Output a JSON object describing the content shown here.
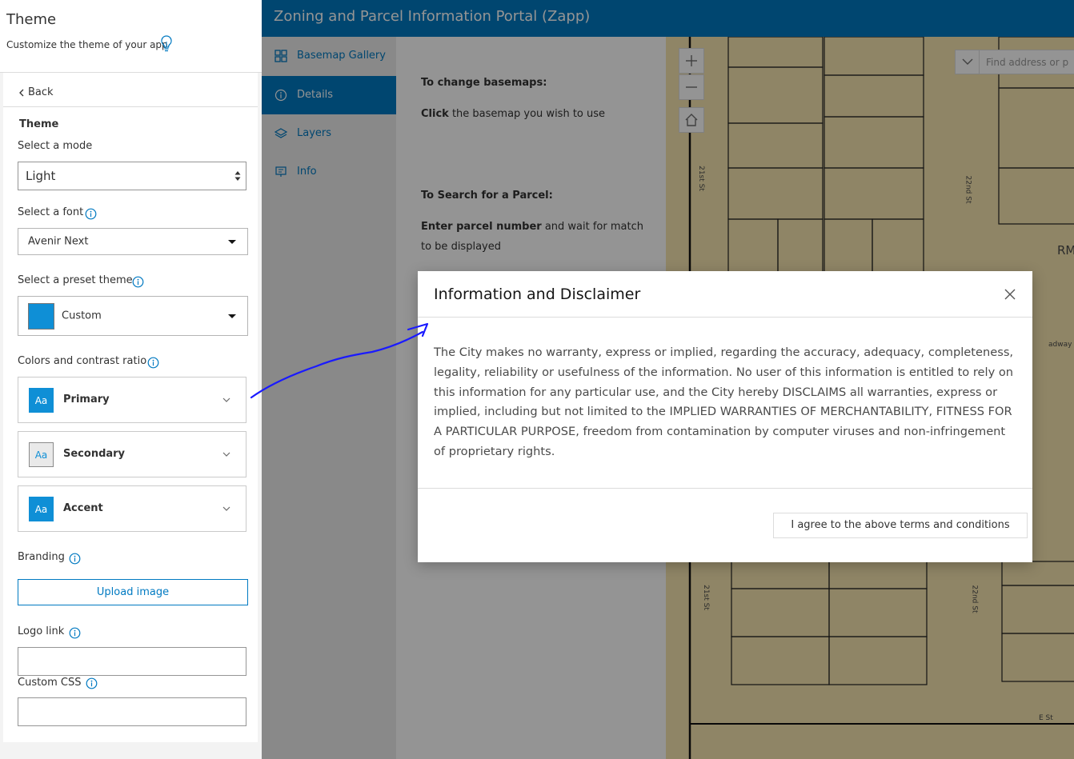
{
  "panel": {
    "title": "Theme",
    "subtitle": "Customize the theme of your app",
    "back_label": "Back",
    "section_title": "Theme",
    "mode_label": "Select a mode",
    "mode_value": "Light",
    "font_label": "Select a font",
    "font_value": "Avenir Next",
    "preset_label": "Select a preset theme",
    "preset_value": "Custom",
    "preset_color": "#0f8fd6",
    "colors_label": "Colors and contrast ratio",
    "colors": [
      {
        "label": "Primary",
        "swatch_text": "Aa",
        "swatch_bg": "#0f8fd6",
        "swatch_fg": "#ffffff"
      },
      {
        "label": "Secondary",
        "swatch_text": "Aa",
        "swatch_bg": "#e9e9e9",
        "swatch_fg": "#0f8fd6"
      },
      {
        "label": "Accent",
        "swatch_text": "Aa",
        "swatch_bg": "#0f8fd6",
        "swatch_fg": "#ffffff"
      }
    ],
    "branding_label": "Branding",
    "upload_label": "Upload image",
    "logo_link_label": "Logo link",
    "logo_link_value": "",
    "custom_css_label": "Custom CSS",
    "custom_css_value": ""
  },
  "app": {
    "title": "Zoning and Parcel Information Portal (Zapp)",
    "nav": [
      {
        "label": "Basemap Gallery",
        "icon": "grid-icon",
        "active": false
      },
      {
        "label": "Details",
        "icon": "info-icon",
        "active": true
      },
      {
        "label": "Layers",
        "icon": "layers-icon",
        "active": false
      },
      {
        "label": "Info",
        "icon": "presentation-icon",
        "active": false
      }
    ],
    "details": {
      "basemap_heading": "To change basemaps:",
      "basemap_bold": "Click",
      "basemap_rest": " the basemap you wish to use",
      "parcel_heading": "To Search for a Parcel:",
      "parcel_bold": "Enter parcel number",
      "parcel_rest": " and wait for match to be displayed"
    },
    "map": {
      "search_placeholder": "Find address or p",
      "labels": [
        "21st St",
        "22nd St",
        "RM",
        "adway",
        "21st St",
        "22nd St",
        "E St"
      ]
    }
  },
  "modal": {
    "title": "Information and Disclaimer",
    "body": "The City makes no warranty, express or implied, regarding the accuracy, adequacy, completeness, legality, reliability or usefulness of the information. No user of this information is entitled to rely on this information for any particular use, and the City hereby DISCLAIMS all warranties, express or implied, including but not limited to the IMPLIED WARRANTIES OF MERCHANTABILITY, FITNESS FOR A PARTICULAR PURPOSE, freedom from contamination by computer viruses and non-infringement of proprietary rights.",
    "agree_label": "I agree to the above terms and conditions"
  },
  "colors": {
    "brand_blue": "#0079c1",
    "annotation": "#1a1aff"
  }
}
